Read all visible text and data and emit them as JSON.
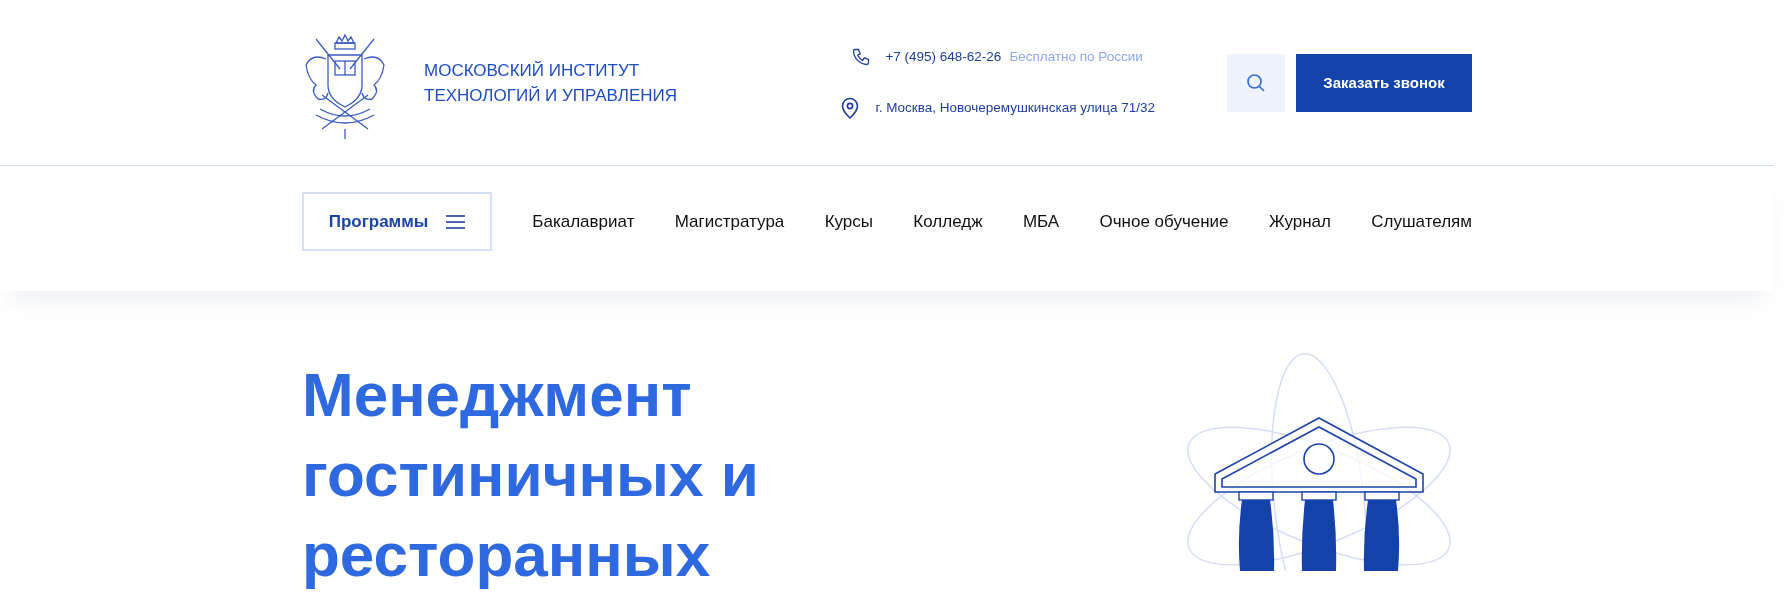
{
  "header": {
    "logo_lines": [
      "МОСКОВСКИЙ ИНСТИТУТ",
      "ТЕХНОЛОГИЙ И УПРАВЛЕНИЯ"
    ],
    "phone": "+7 (495) 648-62-26",
    "phone_note": "Бесплатно по России",
    "address": "г. Москва, Новочеремушкинская улица 71/32",
    "callback_button": "Заказать звонок"
  },
  "nav": {
    "programs_button": "Программы",
    "items": [
      "Бакалавриат",
      "Магистратура",
      "Курсы",
      "Колледж",
      "МБА",
      "Очное обучение",
      "Журнал",
      "Слушателям"
    ]
  },
  "hero": {
    "title": "Менеджмент гостиничных и ресторанных"
  }
}
